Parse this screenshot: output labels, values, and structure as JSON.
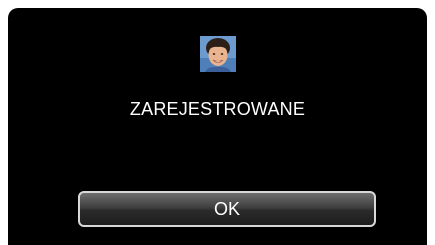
{
  "dialog": {
    "status_text": "ZAREJESTROWANE",
    "ok_label": "OK"
  },
  "colors": {
    "screen_background": "#000000",
    "text": "#ffffff",
    "button_border": "#d8d8d8"
  }
}
